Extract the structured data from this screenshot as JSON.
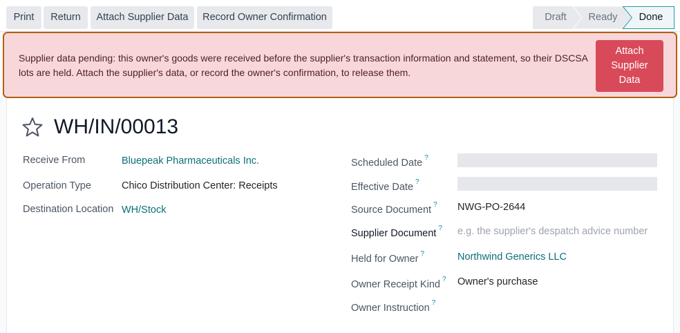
{
  "toolbar": {
    "print_label": "Print",
    "return_label": "Return",
    "attach_supplier_label": "Attach Supplier Data",
    "record_owner_label": "Record Owner Confirmation"
  },
  "status": {
    "steps": [
      "Draft",
      "Ready",
      "Done"
    ],
    "current": "Done"
  },
  "alert": {
    "message": "Supplier data pending: this owner's goods were received before the supplier's transaction information and statement, so their DSCSA lots are held. Attach the supplier's data, or record the owner's confirmation, to release them.",
    "button_label": "Attach Supplier Data"
  },
  "record": {
    "title": "WH/IN/00013"
  },
  "left_fields": {
    "receive_from": {
      "label": "Receive From",
      "value": "Bluepeak Pharmaceuticals Inc."
    },
    "operation_type": {
      "label": "Operation Type",
      "value": "Chico Distribution Center: Receipts"
    },
    "destination_location": {
      "label": "Destination Location",
      "value": "WH/Stock"
    }
  },
  "right_fields": {
    "scheduled_date": {
      "label": "Scheduled Date",
      "help": "?",
      "value": ""
    },
    "effective_date": {
      "label": "Effective Date",
      "help": "?",
      "value": ""
    },
    "source_document": {
      "label": "Source Document",
      "help": "?",
      "value": "NWG-PO-2644"
    },
    "supplier_document": {
      "label": "Supplier Document",
      "help": "?",
      "placeholder": "e.g. the supplier's despatch advice number"
    },
    "held_for_owner": {
      "label": "Held for Owner",
      "help": "?",
      "value": "Northwind Generics LLC"
    },
    "owner_receipt_kind": {
      "label": "Owner Receipt Kind",
      "help": "?",
      "value": "Owner's purchase"
    },
    "owner_instruction": {
      "label": "Owner Instruction",
      "help": "?",
      "value": ""
    }
  },
  "colors": {
    "alert_bg": "#f8d7da",
    "alert_border": "#b35f12",
    "alert_button": "#d84a59",
    "link": "#0a6f78",
    "help_marker": "#0e8ba3"
  },
  "icons": {
    "favorite": "star-outline-icon"
  }
}
